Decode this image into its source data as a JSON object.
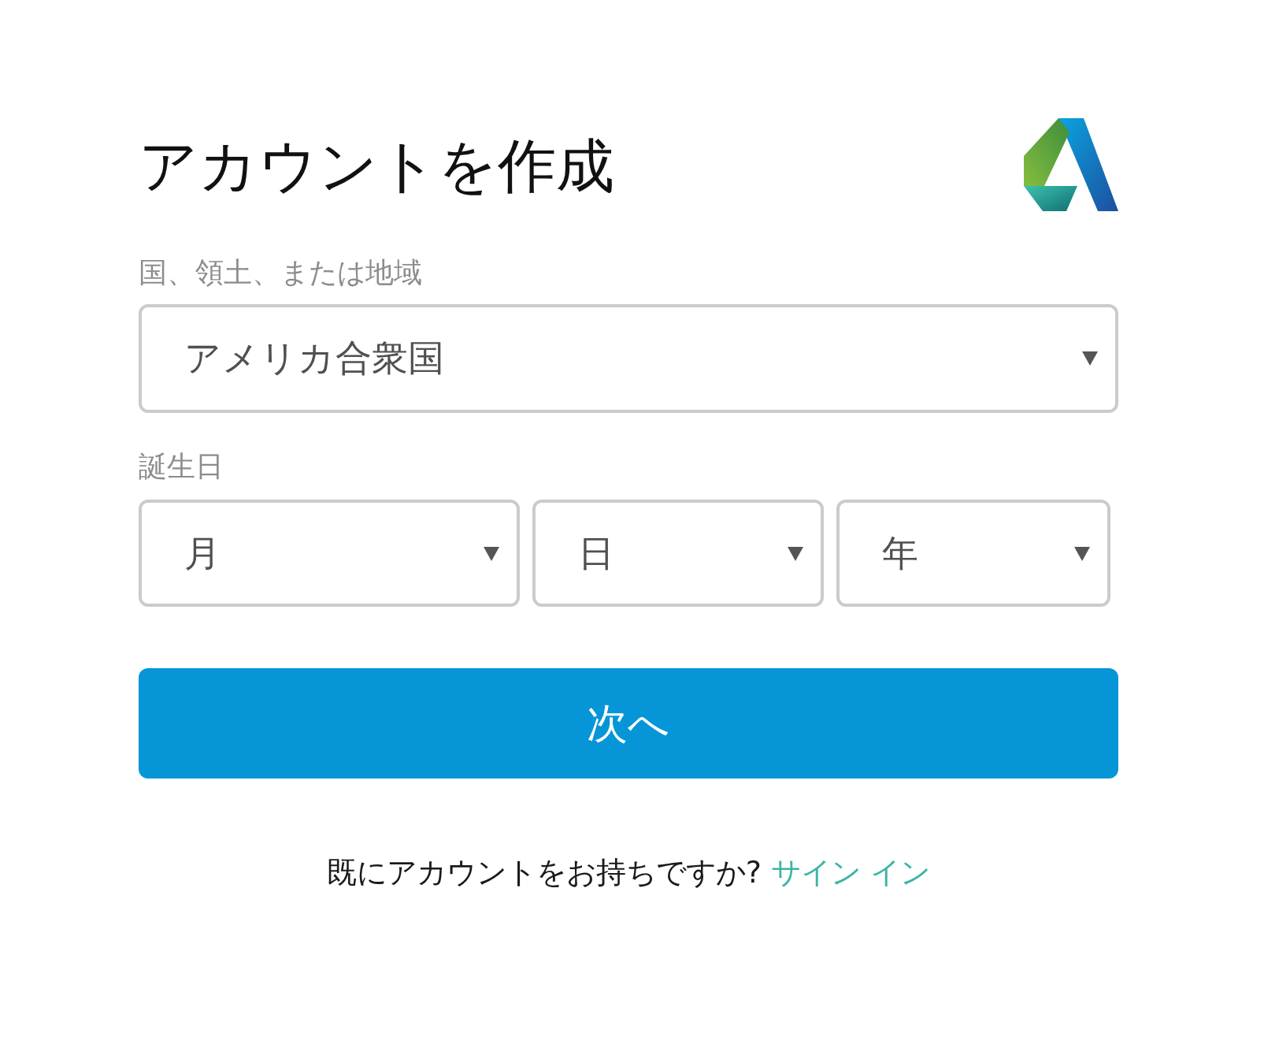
{
  "header": {
    "title": "アカウントを作成"
  },
  "form": {
    "country_field": {
      "label": "国、領土、または地域",
      "value": "アメリカ合衆国"
    },
    "birthdate": {
      "label": "誕生日",
      "selects": [
        {
          "value": "月"
        },
        {
          "value": "日"
        },
        {
          "value": "年"
        }
      ]
    },
    "next_button": "次へ"
  },
  "footer": {
    "prompt": "既にアカウントをお持ちですか?",
    "link": "サイン イン"
  }
}
